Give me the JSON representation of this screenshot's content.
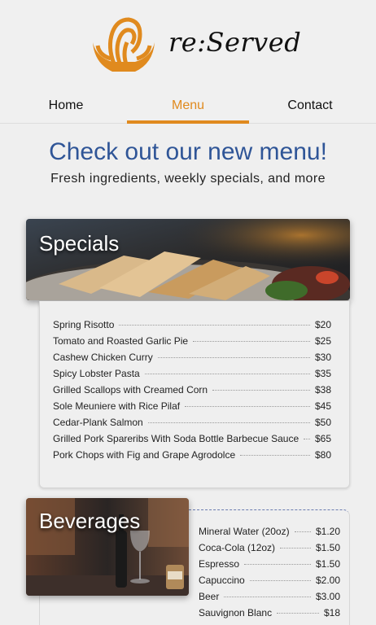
{
  "brand": {
    "name": "re:Served"
  },
  "nav": [
    {
      "label": "Home",
      "active": false
    },
    {
      "label": "Menu",
      "active": true
    },
    {
      "label": "Contact",
      "active": false
    }
  ],
  "hero": {
    "title": "Check out our new menu!",
    "subtitle": "Fresh ingredients, weekly specials, and more"
  },
  "specials": {
    "title": "Specials",
    "items": [
      {
        "name": "Spring Risotto",
        "price": "$20"
      },
      {
        "name": "Tomato and Roasted Garlic Pie",
        "price": "$25"
      },
      {
        "name": "Cashew Chicken Curry",
        "price": "$30"
      },
      {
        "name": "Spicy Lobster Pasta",
        "price": "$35"
      },
      {
        "name": "Grilled Scallops with Creamed Corn",
        "price": "$38"
      },
      {
        "name": "Sole Meuniere with Rice Pilaf",
        "price": "$45"
      },
      {
        "name": "Cedar-Plank Salmon",
        "price": "$50"
      },
      {
        "name": "Grilled Pork Spareribs With Soda Bottle Barbecue Sauce",
        "price": "$65"
      },
      {
        "name": "Pork Chops with Fig and Grape Agrodolce",
        "price": "$80"
      }
    ]
  },
  "beverages": {
    "title": "Beverages",
    "items": [
      {
        "name": "Mineral Water (20oz)",
        "price": "$1.20"
      },
      {
        "name": "Coca-Cola (12oz)",
        "price": "$1.50"
      },
      {
        "name": "Espresso",
        "price": "$1.50"
      },
      {
        "name": "Capuccino",
        "price": "$2.00"
      },
      {
        "name": "Beer",
        "price": "$3.00"
      },
      {
        "name": "Sauvignon Blanc",
        "price": "$18"
      }
    ]
  },
  "colors": {
    "accent": "#e08a1e",
    "headline": "#2f5597"
  }
}
